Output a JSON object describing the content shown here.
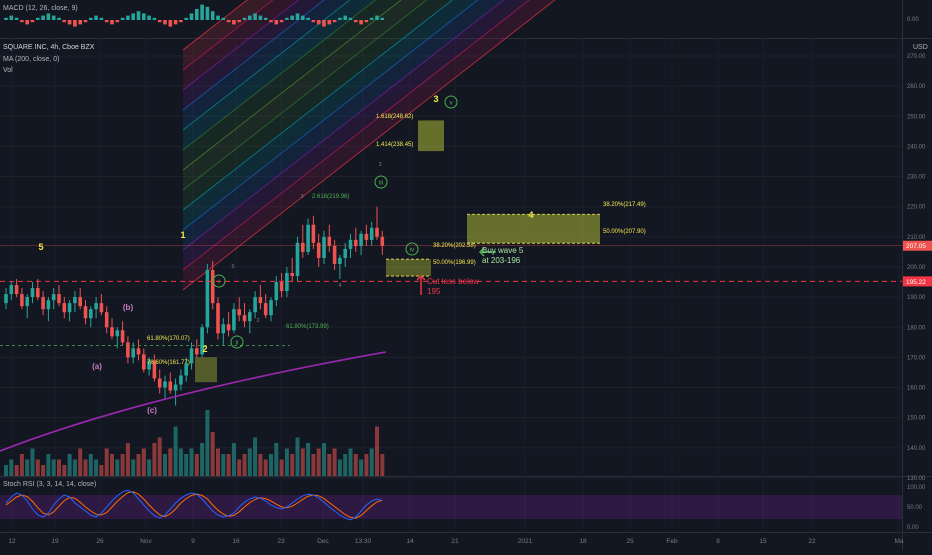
{
  "header": {
    "macd_label": "MACD (12, 26, close, 9)",
    "symbol_label": "SQUARE INC, 4h, Cboe BZX",
    "ma_label": "MA (200, close, 0)",
    "vol_label": "Vol",
    "stoch_label": "Stoch RSI (3, 3, 14, 14, close)",
    "currency": "USD"
  },
  "price_axis": {
    "ticks": [
      "270.00",
      "260.00",
      "250.00",
      "240.00",
      "230.00",
      "220.00",
      "210.00",
      "200.00",
      "190.00",
      "180.00",
      "170.00",
      "160.00",
      "150.00",
      "140.00",
      "130.00"
    ],
    "macd_ticks": [
      "0.00"
    ],
    "stoch_ticks": [
      "100.00",
      "50.00",
      "0.00"
    ],
    "last_price": "207.05",
    "alert_price": "195.22"
  },
  "time_axis": {
    "ticks": [
      "12",
      "19",
      "26",
      "Nov",
      "9",
      "16",
      "23",
      "Dec",
      "13:30",
      "14",
      "21",
      "2021",
      "18",
      "25",
      "Feb",
      "8",
      "15",
      "22",
      "Ma"
    ]
  },
  "annotations": {
    "wave_labels": [
      "5",
      "(b)",
      "(a)",
      "(c)",
      "1",
      "2",
      "3",
      "4",
      "i",
      "ii",
      "iii",
      "iv",
      "v"
    ],
    "fib_labels": [
      "1.618(248.62)",
      "1.414(238.45)",
      "2.618(219.96)",
      "61.80%(173.99)",
      "61.80%(170.07)",
      "78.60%(161.77)",
      "38.20%(217.49)",
      "50.00%(207.90)",
      "38.20%(202.58)",
      "50.00%(196.99)"
    ],
    "small_marks": [
      "3",
      "3",
      "5",
      "4",
      "2"
    ],
    "buy_note_line1": "Buy wave 5",
    "buy_note_line2": "at 203-196",
    "stop_note_line1": "Cut loss below",
    "stop_note_line2": "195"
  },
  "colors": {
    "background": "#131722",
    "up": "#26a69a",
    "down": "#ef5350",
    "ma": "#9c27b0",
    "stoch_k": "#2962ff",
    "stoch_d": "#ff6d00",
    "wave_yellow": "#f7e94e",
    "wave_green": "#4caf50",
    "stop_red": "#f23645"
  },
  "chart_data": {
    "type": "candlestick",
    "symbol": "SQUARE INC",
    "interval": "4h",
    "exchange": "Cboe BZX",
    "ylim": [
      124,
      272
    ],
    "ohlc": [
      [
        188,
        193,
        186,
        191
      ],
      [
        191,
        195,
        189,
        194
      ],
      [
        194,
        196,
        190,
        191
      ],
      [
        191,
        193,
        186,
        187
      ],
      [
        187,
        191,
        183,
        190
      ],
      [
        190,
        195,
        188,
        193
      ],
      [
        193,
        196,
        189,
        190
      ],
      [
        190,
        192,
        184,
        186
      ],
      [
        186,
        190,
        182,
        189
      ],
      [
        189,
        193,
        186,
        191
      ],
      [
        191,
        194,
        187,
        188
      ],
      [
        188,
        190,
        183,
        185
      ],
      [
        185,
        189,
        182,
        188
      ],
      [
        188,
        192,
        185,
        190
      ],
      [
        190,
        193,
        186,
        187
      ],
      [
        187,
        189,
        181,
        183
      ],
      [
        183,
        187,
        180,
        186
      ],
      [
        186,
        190,
        183,
        188
      ],
      [
        188,
        191,
        184,
        185
      ],
      [
        185,
        187,
        178,
        180
      ],
      [
        180,
        183,
        176,
        177
      ],
      [
        177,
        180,
        173,
        179
      ],
      [
        179,
        182,
        174,
        175
      ],
      [
        175,
        177,
        168,
        170
      ],
      [
        170,
        175,
        168,
        173
      ],
      [
        173,
        176,
        169,
        171
      ],
      [
        171,
        173,
        165,
        166
      ],
      [
        166,
        170,
        164,
        169
      ],
      [
        169,
        171,
        162,
        163
      ],
      [
        163,
        166,
        158,
        160
      ],
      [
        160,
        164,
        156,
        162
      ],
      [
        162,
        165,
        158,
        159
      ],
      [
        159,
        163,
        154,
        161
      ],
      [
        161,
        166,
        159,
        164
      ],
      [
        164,
        170,
        162,
        168
      ],
      [
        168,
        175,
        166,
        173
      ],
      [
        173,
        176,
        170,
        171
      ],
      [
        171,
        181,
        170,
        180
      ],
      [
        180,
        201,
        178,
        199
      ],
      [
        199,
        202,
        186,
        188
      ],
      [
        188,
        190,
        176,
        178
      ],
      [
        178,
        183,
        174,
        181
      ],
      [
        181,
        185,
        177,
        179
      ],
      [
        179,
        188,
        178,
        186
      ],
      [
        186,
        190,
        182,
        184
      ],
      [
        184,
        188,
        180,
        182
      ],
      [
        182,
        186,
        178,
        185
      ],
      [
        185,
        192,
        183,
        190
      ],
      [
        190,
        194,
        186,
        188
      ],
      [
        188,
        191,
        183,
        184
      ],
      [
        184,
        190,
        182,
        189
      ],
      [
        189,
        197,
        187,
        195
      ],
      [
        195,
        198,
        190,
        192
      ],
      [
        192,
        200,
        190,
        198
      ],
      [
        198,
        203,
        195,
        197
      ],
      [
        197,
        210,
        195,
        208
      ],
      [
        208,
        214,
        203,
        205
      ],
      [
        205,
        216,
        204,
        214
      ],
      [
        214,
        217,
        206,
        208
      ],
      [
        208,
        211,
        200,
        203
      ],
      [
        203,
        212,
        201,
        210
      ],
      [
        210,
        214,
        205,
        207
      ],
      [
        207,
        209,
        199,
        201
      ],
      [
        201,
        204,
        196,
        203
      ],
      [
        203,
        208,
        200,
        206
      ],
      [
        206,
        211,
        203,
        209
      ],
      [
        209,
        213,
        205,
        207
      ],
      [
        207,
        212,
        204,
        211
      ],
      [
        211,
        214,
        207,
        209
      ],
      [
        209,
        215,
        207,
        213
      ],
      [
        213,
        220,
        209,
        210
      ],
      [
        210,
        212,
        204,
        207
      ]
    ],
    "volume": [
      2,
      3,
      2,
      4,
      3,
      5,
      3,
      2,
      4,
      3,
      3,
      2,
      4,
      3,
      5,
      3,
      4,
      3,
      2,
      5,
      4,
      3,
      4,
      6,
      3,
      4,
      5,
      3,
      6,
      7,
      4,
      5,
      9,
      5,
      4,
      5,
      4,
      6,
      12,
      8,
      5,
      4,
      4,
      6,
      3,
      4,
      5,
      7,
      4,
      3,
      4,
      6,
      3,
      5,
      4,
      7,
      5,
      6,
      4,
      5,
      6,
      4,
      5,
      3,
      4,
      5,
      4,
      3,
      4,
      5,
      9,
      4
    ],
    "ma200": [
      [
        0,
        148
      ],
      [
        40,
        160
      ],
      [
        80,
        172
      ],
      [
        100,
        177
      ]
    ],
    "stoch_rsi_k": [
      60,
      75,
      85,
      80,
      65,
      45,
      30,
      25,
      35,
      55,
      70,
      80,
      75,
      60,
      50,
      40,
      30,
      25,
      35,
      50,
      65,
      78,
      88,
      92,
      85,
      70,
      55,
      40,
      28,
      22,
      30,
      45,
      60,
      72,
      80,
      85,
      82,
      70,
      55,
      40,
      30,
      25,
      28,
      35,
      50,
      62,
      70,
      75,
      72,
      65,
      55,
      48,
      45,
      50,
      60,
      70,
      78,
      82,
      80,
      72,
      62,
      50,
      40,
      30,
      22,
      18,
      25,
      40,
      55,
      65,
      70,
      66
    ],
    "stoch_rsi_d": [
      55,
      65,
      75,
      80,
      76,
      64,
      48,
      35,
      30,
      38,
      52,
      66,
      74,
      72,
      62,
      50,
      40,
      32,
      30,
      36,
      50,
      64,
      76,
      86,
      88,
      82,
      70,
      55,
      42,
      30,
      26,
      33,
      45,
      60,
      71,
      79,
      82,
      79,
      70,
      55,
      42,
      32,
      27,
      29,
      38,
      50,
      61,
      69,
      73,
      71,
      65,
      57,
      50,
      48,
      52,
      60,
      69,
      77,
      80,
      78,
      71,
      61,
      51,
      41,
      31,
      24,
      22,
      29,
      41,
      53,
      63,
      67
    ],
    "macd_hist": [
      1,
      2,
      1,
      -1,
      -2,
      -1,
      1,
      2,
      3,
      2,
      1,
      -1,
      -2,
      -3,
      -2,
      -1,
      1,
      2,
      1,
      -1,
      -2,
      -1,
      1,
      2,
      3,
      4,
      3,
      2,
      1,
      -1,
      -2,
      -3,
      -2,
      -1,
      1,
      3,
      5,
      7,
      6,
      4,
      2,
      1,
      -1,
      -2,
      -1,
      1,
      2,
      3,
      2,
      1,
      -1,
      -2,
      -1,
      1,
      2,
      3,
      2,
      1,
      -1,
      -2,
      -3,
      -2,
      -1,
      1,
      2,
      1,
      -1,
      -2,
      -1,
      1,
      2,
      1
    ],
    "levels": {
      "last_price": 207.05,
      "cut_loss": 195.22,
      "fib_61_8_wave1": 173.99,
      "wave4_target_38_2": 217.49,
      "wave4_target_50": 207.9,
      "wave_iv_38_2": 202.58,
      "wave_iv_50": 196.99,
      "wave_iii_ext_2_618": 219.96,
      "wave3_target_1_414": 238.45,
      "wave3_target_1_618": 248.62,
      "wave2_61_8": 170.07,
      "wave2_78_6": 161.77
    }
  }
}
